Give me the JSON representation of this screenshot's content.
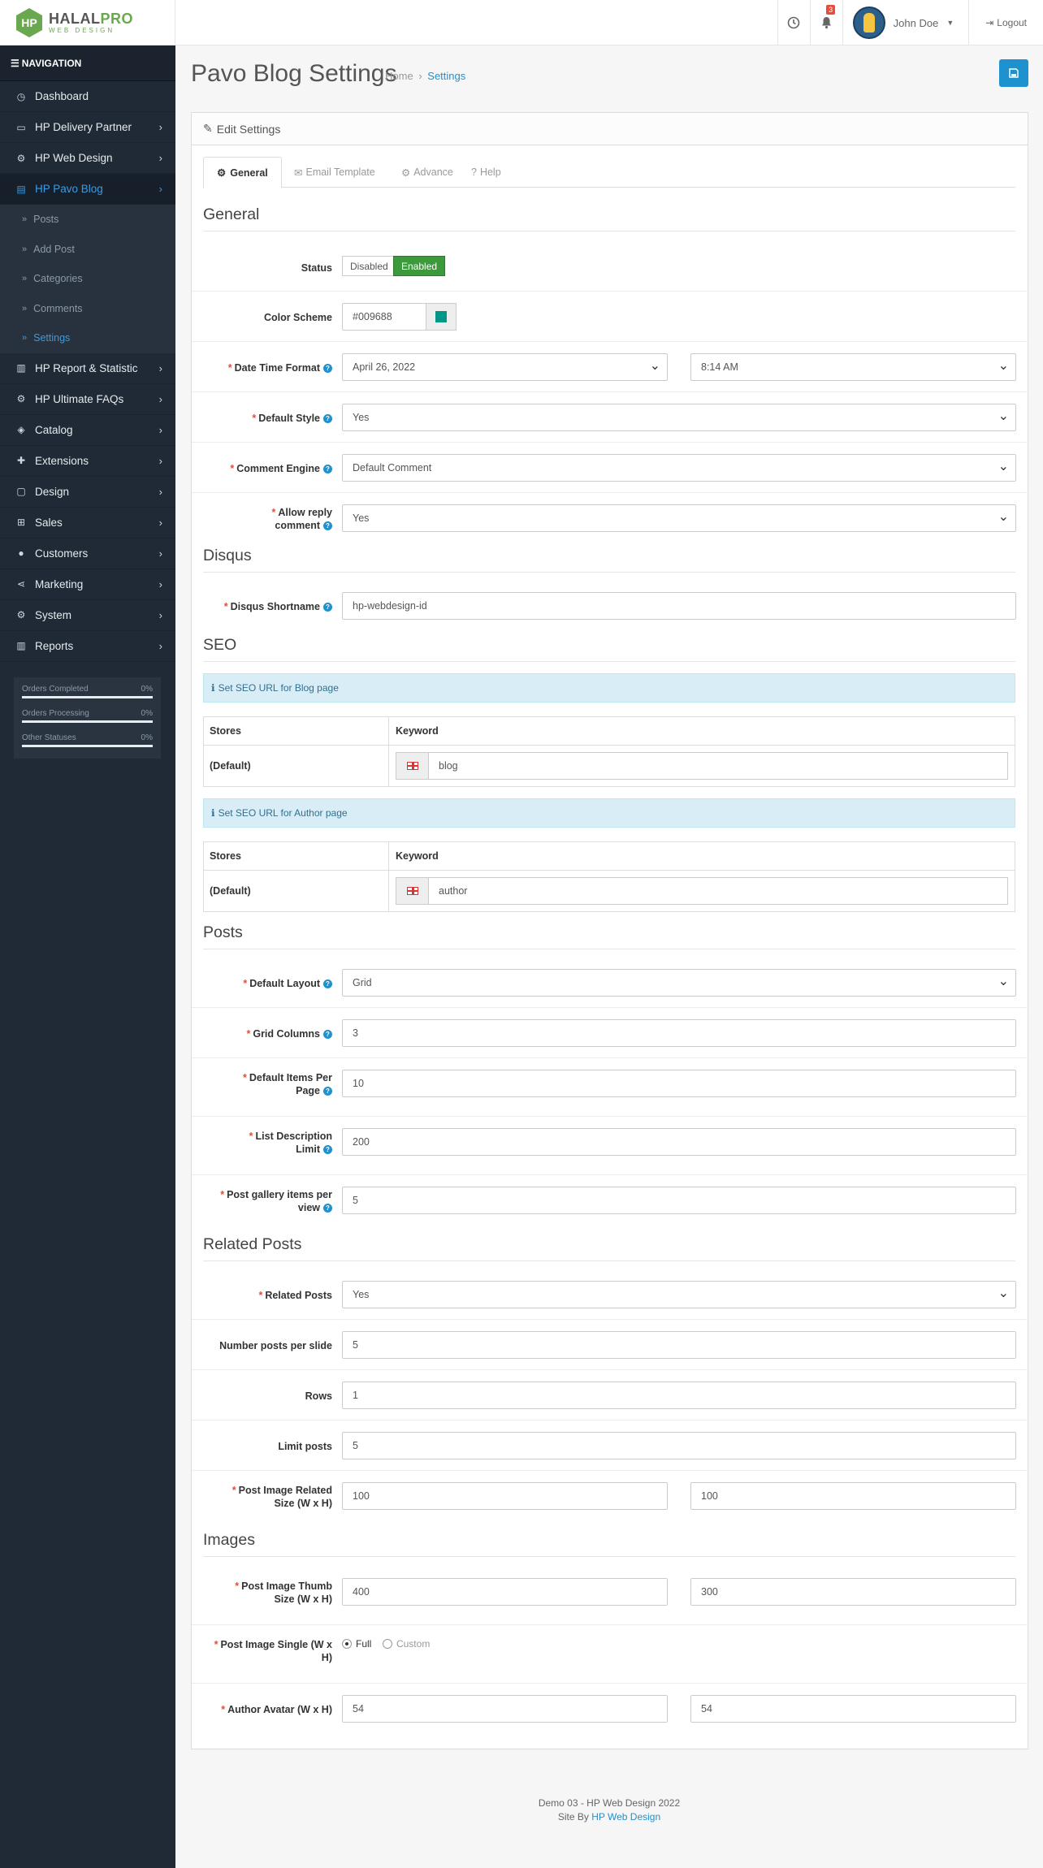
{
  "header": {
    "logo_text_1": "HALAL",
    "logo_text_2": "PRO",
    "logo_sub": "WEB DESIGN",
    "notif_count": "3",
    "user_name": "John Doe",
    "logout": "Logout"
  },
  "sidebar": {
    "heading": "NAVIGATION",
    "items": [
      {
        "label": "Dashboard",
        "icon": "dashboard-icon"
      },
      {
        "label": "HP Delivery Partner",
        "icon": "card-icon"
      },
      {
        "label": "HP Web Design",
        "icon": "cogs-icon"
      },
      {
        "label": "HP Pavo Blog",
        "icon": "blog-icon"
      },
      {
        "label": "HP Report & Statistic",
        "icon": "bar-chart-icon"
      },
      {
        "label": "HP Ultimate FAQs",
        "icon": "cogs-icon"
      },
      {
        "label": "Catalog",
        "icon": "tag-icon"
      },
      {
        "label": "Extensions",
        "icon": "puzzle-icon"
      },
      {
        "label": "Design",
        "icon": "monitor-icon"
      },
      {
        "label": "Sales",
        "icon": "cart-icon"
      },
      {
        "label": "Customers",
        "icon": "user-icon"
      },
      {
        "label": "Marketing",
        "icon": "share-icon"
      },
      {
        "label": "System",
        "icon": "gear-icon"
      },
      {
        "label": "Reports",
        "icon": "bar-chart-icon"
      }
    ],
    "sub_items": [
      "Posts",
      "Add Post",
      "Categories",
      "Comments",
      "Settings"
    ],
    "stats": [
      {
        "label": "Orders Completed",
        "value": "0%"
      },
      {
        "label": "Orders Processing",
        "value": "0%"
      },
      {
        "label": "Other Statuses",
        "value": "0%"
      }
    ]
  },
  "page": {
    "title": "Pavo Blog Settings",
    "crumb_home": "Home",
    "crumb_sep": "›",
    "crumb_current": "Settings",
    "panel_title": "Edit Settings",
    "tabs": [
      "General",
      "Email Template",
      "Advance",
      "Help"
    ]
  },
  "general": {
    "section": "General",
    "status_label": "Status",
    "status_off": "Disabled",
    "status_on": "Enabled",
    "color_label": "Color Scheme",
    "color_value": "#009688",
    "datetime_label": "Date Time Format",
    "date_value": "April 26, 2022",
    "time_value": "8:14 AM",
    "default_style_label": "Default Style",
    "default_style_value": "Yes",
    "comment_engine_label": "Comment Engine",
    "comment_engine_value": "Default Comment",
    "allow_reply_label": "Allow reply comment",
    "allow_reply_value": "Yes"
  },
  "disqus": {
    "section": "Disqus",
    "shortname_label": "Disqus Shortname",
    "shortname_value": "hp-webdesign-id"
  },
  "seo": {
    "section": "SEO",
    "blog_info": "Set SEO URL for Blog page",
    "author_info": "Set SEO URL for Author page",
    "col_stores": "Stores",
    "col_keyword": "Keyword",
    "store_default": "(Default)",
    "blog_keyword": "blog",
    "author_keyword": "author"
  },
  "posts": {
    "section": "Posts",
    "layout_label": "Default Layout",
    "layout_value": "Grid",
    "grid_label": "Grid Columns",
    "grid_value": "3",
    "items_label": "Default Items Per Page",
    "items_value": "10",
    "desc_label": "List Description Limit",
    "desc_value": "200",
    "gallery_label": "Post gallery items per view",
    "gallery_value": "5"
  },
  "related": {
    "section": "Related Posts",
    "related_label": "Related Posts",
    "related_value": "Yes",
    "per_slide_label": "Number posts per slide",
    "per_slide_value": "5",
    "rows_label": "Rows",
    "rows_value": "1",
    "limit_label": "Limit posts",
    "limit_value": "5",
    "img_label": "Post Image Related Size (W x H)",
    "img_w": "100",
    "img_h": "100"
  },
  "images": {
    "section": "Images",
    "thumb_label": "Post Image Thumb Size (W x H)",
    "thumb_w": "400",
    "thumb_h": "300",
    "single_label": "Post Image Single (W x H)",
    "single_full": "Full",
    "single_custom": "Custom",
    "avatar_label": "Author Avatar (W x H)",
    "avatar_w": "54",
    "avatar_h": "54"
  },
  "footer": {
    "line1": "Demo 03 - HP Web Design 2022",
    "line2_prefix": "Site By",
    "line2_link": "HP Web Design"
  },
  "colors": {
    "accent": "#1e91cf",
    "sidebar_bg": "#1f2a36",
    "enabled": "#3c9a3c",
    "required": "#e74c3c"
  }
}
